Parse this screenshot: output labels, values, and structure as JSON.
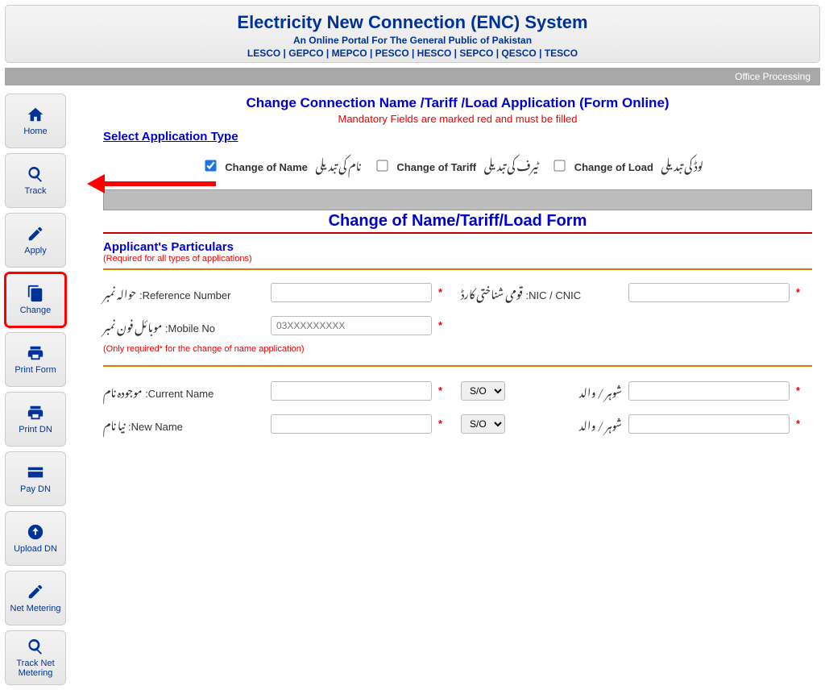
{
  "header": {
    "title": "Electricity New Connection (ENC) System",
    "subtitle": "An Online Portal For The General Public of Pakistan",
    "companies": "LESCO | GEPCO | MEPCO | PESCO | HESCO | SEPCO | QESCO | TESCO"
  },
  "topbar": {
    "office": "Office Processing"
  },
  "sidebar": {
    "home": "Home",
    "track": "Track",
    "apply": "Apply",
    "change": "Change",
    "printform": "Print Form",
    "printdn": "Print DN",
    "paydn": "Pay DN",
    "uploaddn": "Upload DN",
    "netmeter": "Net Metering",
    "tracknet": "Track Net Metering"
  },
  "page": {
    "title": "Change Connection Name /Tariff /Load Application (Form Online)",
    "mandatory": "Mandatory Fields are marked red and must be filled",
    "select_app_type": "Select Application Type",
    "form_title": "Change of Name/Tariff/Load Form"
  },
  "apptype": {
    "name_label": "Change of Name",
    "name_urdu": "نام کی تبدیلی",
    "tariff_label": "Change of Tariff",
    "tariff_urdu": "ٹیرف کی تبدیلی",
    "load_label": "Change of Load",
    "load_urdu": "لوڈ کی تبدیلی"
  },
  "particulars": {
    "heading": "Applicant's Particulars",
    "req": "(Required for all types of applications)",
    "ref_en": ":Reference Number",
    "ref_ur": "حوالہ نمبر",
    "nic_en": ":NIC / CNIC",
    "nic_ur": "قومی شناختی کارڈ",
    "mob_en": ":Mobile No",
    "mob_ur": "موبائل فون نمبر",
    "mob_ph": "03XXXXXXXXX",
    "note": "(Only required* for the change of name application)",
    "curr_en": ":Current Name",
    "curr_ur": "موجودہ نام",
    "new_en": ":New Name",
    "new_ur": "نیا نام",
    "so_opt": "S/O",
    "rel_ur": "شوہر / والد"
  }
}
